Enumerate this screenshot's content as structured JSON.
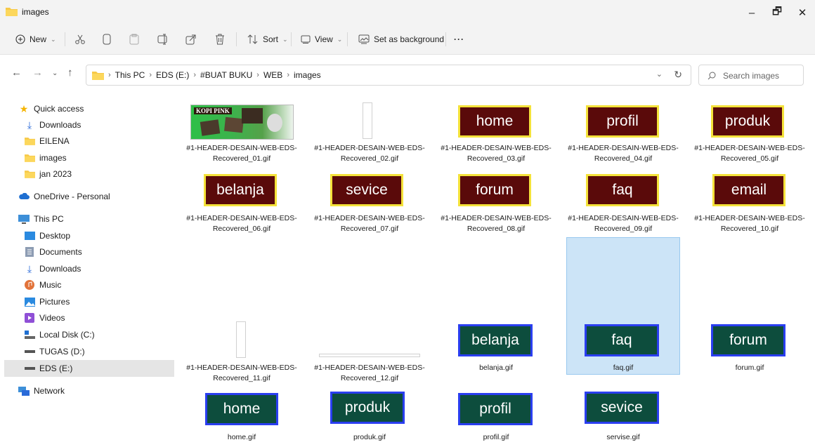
{
  "window": {
    "title": "images"
  },
  "toolbar": {
    "new_label": "New",
    "sort_label": "Sort",
    "view_label": "View",
    "set_bg_label": "Set as background",
    "more_label": "···"
  },
  "address": {
    "crumbs": [
      "This PC",
      "EDS (E:)",
      "#BUAT BUKU",
      "WEB",
      "images"
    ],
    "search_placeholder": "Search images"
  },
  "nav": {
    "quick_access": "Quick access",
    "qa_items": [
      "Downloads",
      "EILENA",
      "images",
      "jan 2023"
    ],
    "onedrive": "OneDrive - Personal",
    "this_pc": "This PC",
    "pc_items": [
      "Desktop",
      "Documents",
      "Downloads",
      "Music",
      "Pictures",
      "Videos",
      "Local Disk (C:)",
      "TUGAS (D:)",
      "EDS (E:)"
    ],
    "network": "Network"
  },
  "files": {
    "f01": "#1-HEADER-DESAIN-WEB-EDS-Recovered_01.gif",
    "f02": "#1-HEADER-DESAIN-WEB-EDS-Recovered_02.gif",
    "f03": "#1-HEADER-DESAIN-WEB-EDS-Recovered_03.gif",
    "f04": "#1-HEADER-DESAIN-WEB-EDS-Recovered_04.gif",
    "f05": "#1-HEADER-DESAIN-WEB-EDS-Recovered_05.gif",
    "f06": "#1-HEADER-DESAIN-WEB-EDS-Recovered_06.gif",
    "f07": "#1-HEADER-DESAIN-WEB-EDS-Recovered_07.gif",
    "f08": "#1-HEADER-DESAIN-WEB-EDS-Recovered_08.gif",
    "f09": "#1-HEADER-DESAIN-WEB-EDS-Recovered_09.gif",
    "f10": "#1-HEADER-DESAIN-WEB-EDS-Recovered_10.gif",
    "f11": "#1-HEADER-DESAIN-WEB-EDS-Recovered_11.gif",
    "f12": "#1-HEADER-DESAIN-WEB-EDS-Recovered_12.gif",
    "belanja": "belanja.gif",
    "faq": "faq.gif",
    "forum": "forum.gif",
    "home": "home.gif",
    "produk": "produk.gif",
    "profil": "profil.gif",
    "servise": "servise.gif"
  },
  "thumbs": {
    "home": "home",
    "profil": "profil",
    "produk": "produk",
    "belanja": "belanja",
    "sevice": "sevice",
    "forum": "forum",
    "faq": "faq",
    "email": "email",
    "banner_logo": "KOPI PINK"
  },
  "colors": {
    "red_btn": "#5a0a0a",
    "yellow_border": "#f4e23a",
    "green_btn": "#0d4d3d",
    "blue_border": "#2a3ef0",
    "selection": "#cce4f7"
  }
}
